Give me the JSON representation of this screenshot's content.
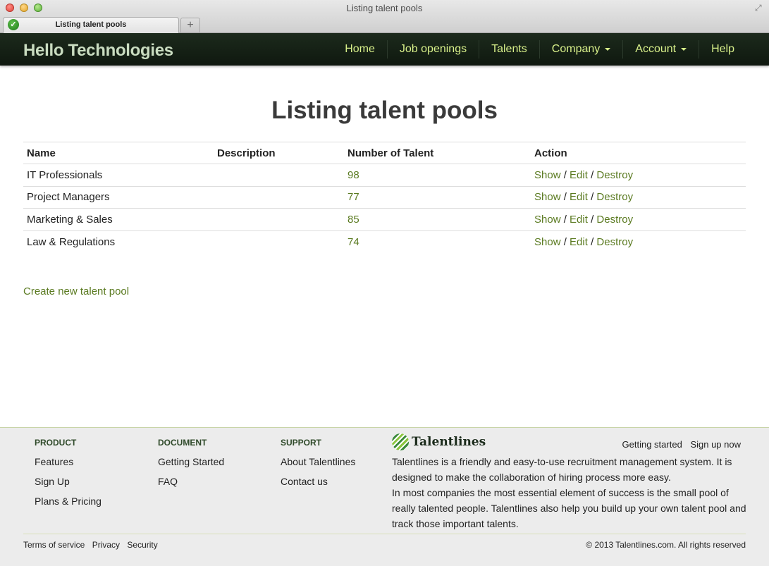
{
  "window": {
    "title": "Listing talent pools",
    "tab_label": "Listing talent pools",
    "new_tab_symbol": "+",
    "fullscreen_symbol": "⤢"
  },
  "navbar": {
    "brand": "Hello Technologies",
    "items": [
      {
        "label": "Home",
        "dropdown": false
      },
      {
        "label": "Job openings",
        "dropdown": false
      },
      {
        "label": "Talents",
        "dropdown": false
      },
      {
        "label": "Company",
        "dropdown": true
      },
      {
        "label": "Account",
        "dropdown": true
      },
      {
        "label": "Help",
        "dropdown": false
      }
    ]
  },
  "main": {
    "title": "Listing talent pools",
    "table": {
      "headers": [
        "Name",
        "Description",
        "Number of Talent",
        "Action"
      ],
      "rows": [
        {
          "name": "IT Professionals",
          "description": "",
          "count": "98"
        },
        {
          "name": "Project Managers",
          "description": "",
          "count": "77"
        },
        {
          "name": "Marketing & Sales",
          "description": "",
          "count": "85"
        },
        {
          "name": "Law & Regulations",
          "description": "",
          "count": "74"
        }
      ],
      "actions": {
        "show": "Show",
        "edit": "Edit",
        "destroy": "Destroy",
        "separator": "/"
      }
    },
    "create_link": "Create new talent pool"
  },
  "footer": {
    "columns": [
      {
        "heading": "PRODUCT",
        "links": [
          "Features",
          "Sign Up",
          "Plans & Pricing"
        ]
      },
      {
        "heading": "DOCUMENT",
        "links": [
          "Getting Started",
          "FAQ"
        ]
      },
      {
        "heading": "SUPPORT",
        "links": [
          "About Talentlines",
          "Contact us"
        ]
      }
    ],
    "logo_text": "Talentlines",
    "top_links": [
      "Getting started",
      "Sign up now"
    ],
    "description": [
      "Talentlines is a friendly and easy-to-use recruitment management system. It is designed to make the collaboration of hiring process more easy.",
      "In most companies the most essential element of success is the small pool of really talented people. Talentlines also help you build up your own talent pool and track those important talents."
    ],
    "legal_links": [
      "Terms of service",
      "Privacy",
      "Security"
    ],
    "copyright": "© 2013 Talentlines.com. All rights reserved"
  },
  "colors": {
    "navbar_bg": "#132013",
    "nav_link": "#d8f08a",
    "link_green": "#5a7a20",
    "footer_bg": "#ececec"
  }
}
